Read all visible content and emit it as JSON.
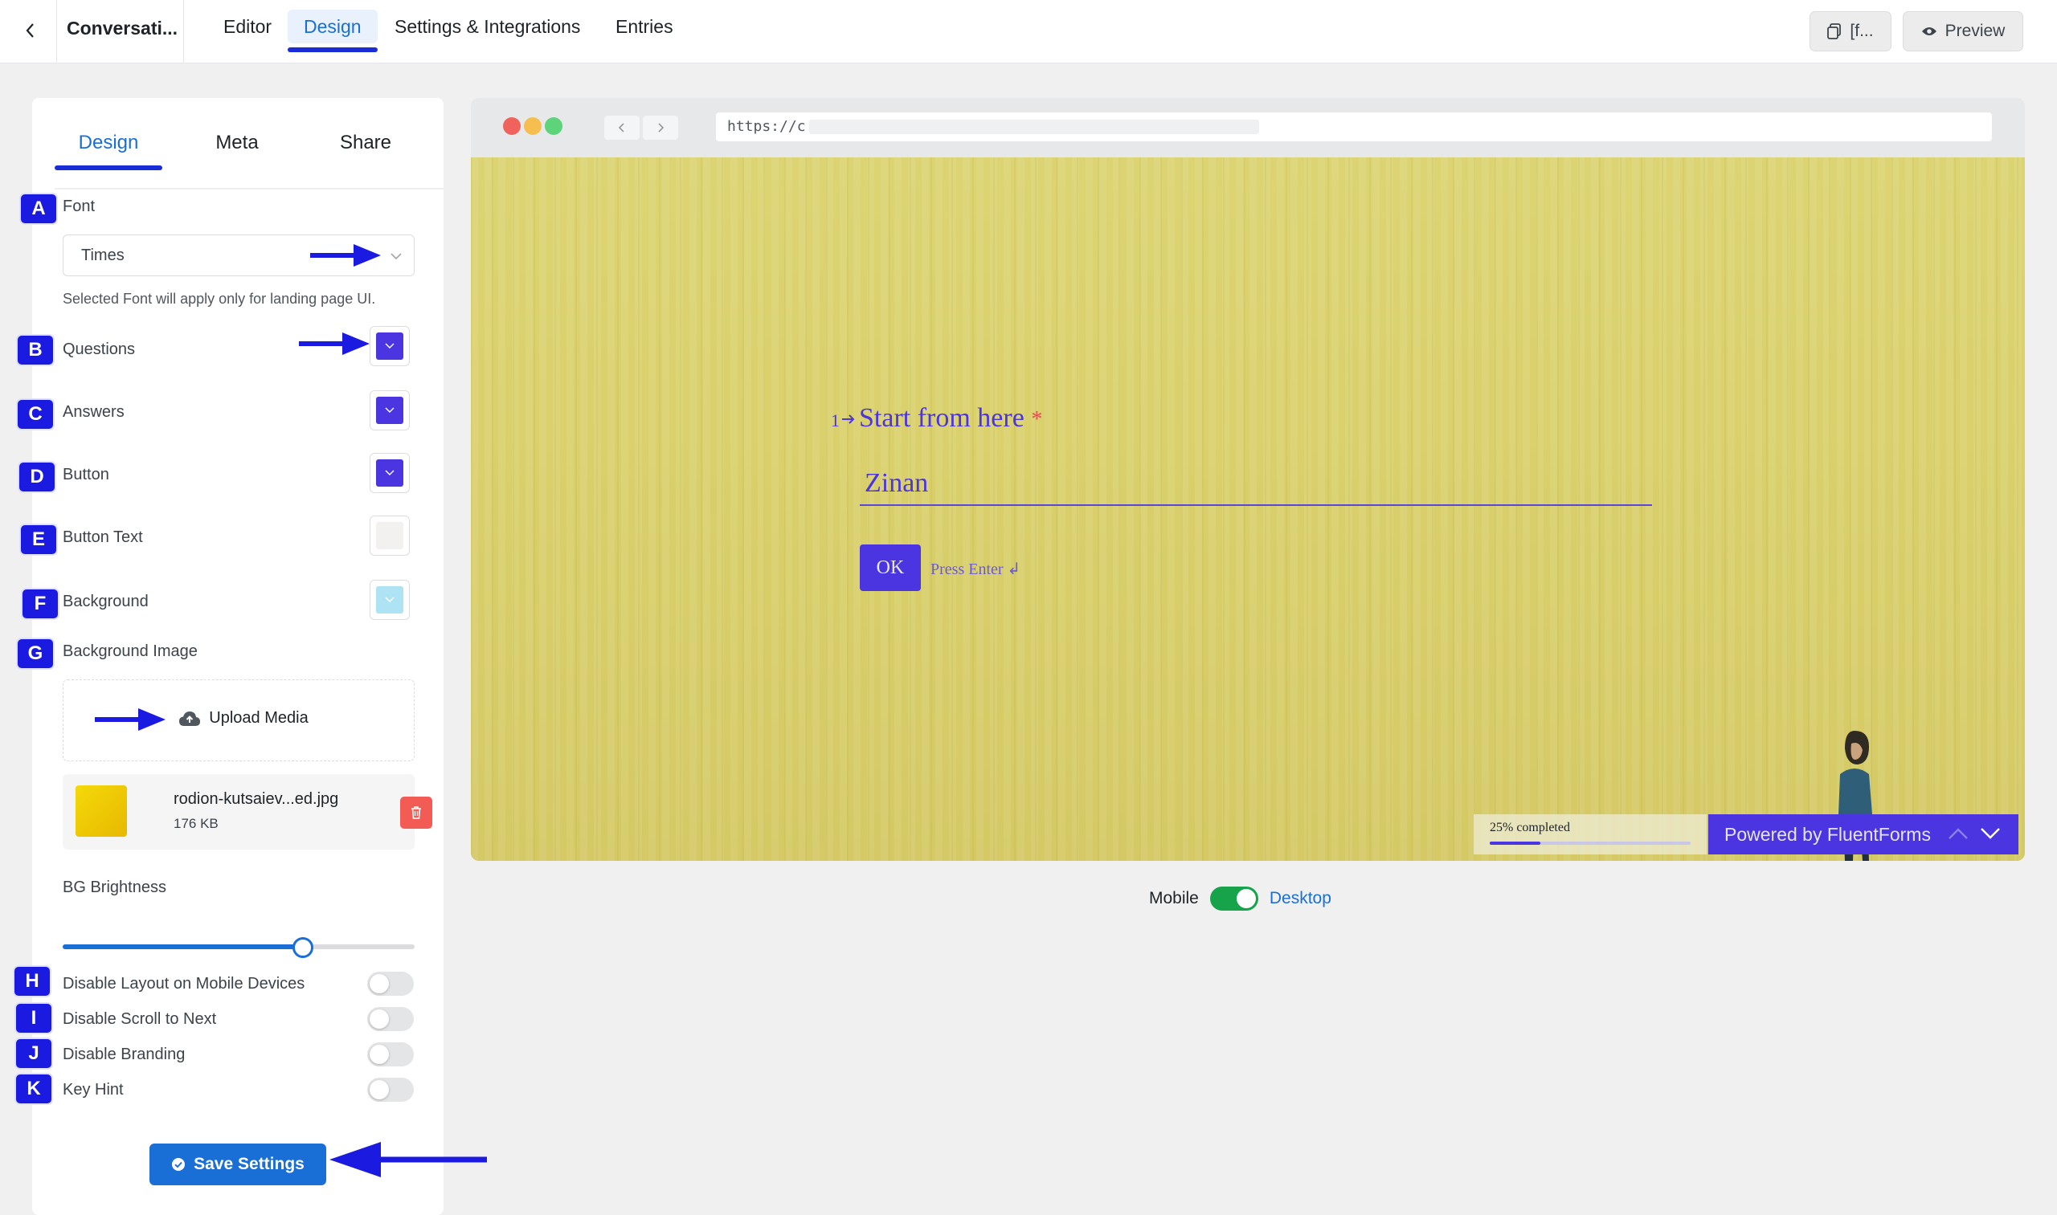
{
  "header": {
    "form_title": "Conversati...",
    "nav": [
      "Editor",
      "Design",
      "Settings & Integrations",
      "Entries"
    ],
    "shortcode_label": "[f...",
    "preview_label": "Preview"
  },
  "panel": {
    "tabs": [
      "Design",
      "Meta",
      "Share"
    ],
    "badges": [
      "A",
      "B",
      "C",
      "D",
      "E",
      "F",
      "G",
      "H",
      "I",
      "J",
      "K"
    ],
    "font": {
      "label": "Font",
      "value": "Times",
      "help": "Selected Font will apply only for landing page UI."
    },
    "colors": {
      "questions": {
        "label": "Questions",
        "value": "#4a35e0"
      },
      "answers": {
        "label": "Answers",
        "value": "#4a35e0"
      },
      "button": {
        "label": "Button",
        "value": "#4a35e0"
      },
      "button_text": {
        "label": "Button Text",
        "value": "#f3f0f0"
      },
      "background": {
        "label": "Background",
        "value": "#aee3f3"
      }
    },
    "background_image": {
      "label": "Background Image",
      "upload_label": "Upload Media",
      "file_name": "rodion-kutsaiev...ed.jpg",
      "file_size": "176 KB"
    },
    "bg_brightness": {
      "label": "BG Brightness",
      "value_fraction": 0.68
    },
    "toggles": [
      {
        "label": "Disable Layout on Mobile Devices",
        "on": false
      },
      {
        "label": "Disable Scroll to Next",
        "on": false
      },
      {
        "label": "Disable Branding",
        "on": false
      },
      {
        "label": "Key Hint",
        "on": false
      }
    ],
    "save_label": "Save Settings"
  },
  "preview": {
    "url": "https://c",
    "question_number": "1",
    "question_text": "Start from here",
    "required_mark": "*",
    "answer_value": "Zinan",
    "ok_label": "OK",
    "press_enter": "Press Enter ↲",
    "progress_text": "25% completed",
    "progress_value": 0.25,
    "branding_prefix": "Powered by ",
    "branding_name": "FluentForms",
    "mobile_label": "Mobile",
    "desktop_label": "Desktop"
  },
  "colors": {
    "accent": "#1a6fd6",
    "annotation_blue": "#1a1ae0",
    "form_purple": "#4a35e0",
    "canvas_yellow": "#dcd472",
    "danger": "#f25c54",
    "toggle_green": "#16a34a"
  },
  "icons": [
    "chevron-left-icon",
    "shortcode-icon",
    "eye-icon",
    "chevron-down-icon",
    "cloud-upload-icon",
    "trash-icon",
    "check-circle-icon",
    "arrow-right-icon",
    "chevron-up-icon"
  ]
}
